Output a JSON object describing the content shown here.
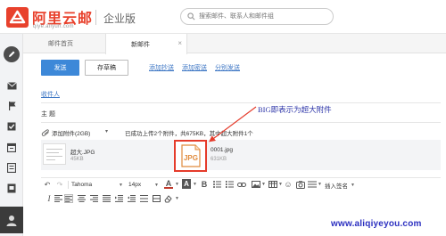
{
  "brand": {
    "name_cn": "阿里云邮",
    "name_en": "qiye.aliyun.com",
    "edition": "企业版"
  },
  "search": {
    "placeholder": "搜索邮件、联系人和邮件组"
  },
  "tabs": [
    {
      "label": "邮件首页"
    },
    {
      "label": "新邮件",
      "close": "×"
    }
  ],
  "actions": {
    "send": "发送",
    "save_draft": "存草稿",
    "add_cc": "添加抄送",
    "add_bcc": "添加密送",
    "separate_send": "分别发送"
  },
  "fields": {
    "to": "收件人",
    "subject": "主  题"
  },
  "attachments": {
    "add_label": "添加附件(2GB)",
    "caret": "▾",
    "status": "已成功上传2个附件，共675KB，其中超大附件1个",
    "items": [
      {
        "name": "超大.JPG",
        "size": "45KB"
      },
      {
        "name": "0001.jpg",
        "size": "631KB"
      }
    ],
    "jpg_badge": "JPG"
  },
  "annotation": {
    "text": "BIG即表示为超大附件"
  },
  "editor": {
    "font": "Tahoma",
    "size": "14px",
    "insert_signature": "插入签名"
  },
  "watermark": "www.aliqiyeyou.com",
  "colors": {
    "brand_red": "#e8412c",
    "primary_blue": "#3d88d8",
    "link_blue": "#3d76c4",
    "annotation_red": "#e53b2b",
    "annotation_text": "#2c34a8"
  },
  "icons": {
    "sidebar": [
      "pencil-icon",
      "inbox-icon",
      "flag-icon",
      "checkbox-icon",
      "calendar-icon",
      "notes-icon",
      "archive-icon",
      "user-icon"
    ]
  }
}
